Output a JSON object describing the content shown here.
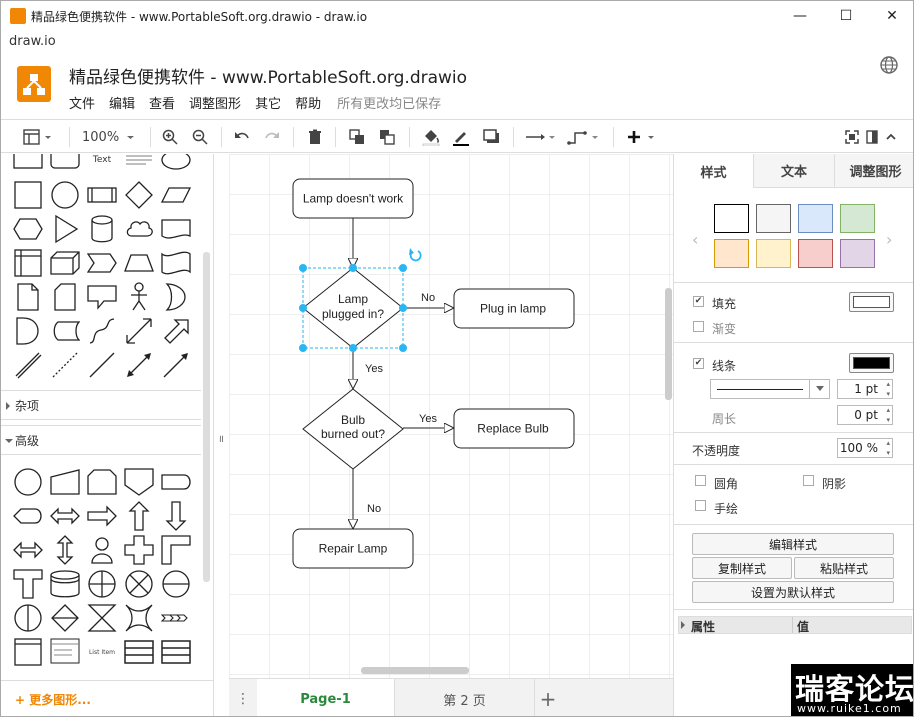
{
  "window": {
    "title": "精品绿色便携软件 - www.PortableSoft.org.drawio - draw.io",
    "minimize": "—",
    "maximize": "☐",
    "close": "✕"
  },
  "app_tab": "draw.io",
  "header": {
    "doc_title": "精品绿色便携软件 - www.PortableSoft.org.drawio",
    "menus": [
      "文件",
      "编辑",
      "查看",
      "调整图形",
      "其它",
      "帮助"
    ],
    "save_status": "所有更改均已保存"
  },
  "toolbar": {
    "zoom": "100%"
  },
  "left_panel": {
    "text_shape_label": "Text",
    "sections": {
      "misc": "杂项",
      "advanced": "高级"
    },
    "list_item_label": "List Item",
    "more_shapes": "+ 更多图形..."
  },
  "diagram": {
    "nodes": {
      "start": "Lamp doesn't work",
      "decision1_l1": "Lamp",
      "decision1_l2": "plugged in?",
      "plug": "Plug in lamp",
      "decision2_l1": "Bulb",
      "decision2_l2": "burned out?",
      "replace": "Replace Bulb",
      "repair": "Repair Lamp"
    },
    "edges": {
      "no1": "No",
      "yes1": "Yes",
      "yes2": "Yes",
      "no2": "No"
    }
  },
  "pages": {
    "tabs": [
      "Page-1",
      "第 2 页"
    ],
    "add": "+"
  },
  "right_panel": {
    "tabs": [
      "样式",
      "文本",
      "调整图形"
    ],
    "swatches": [
      "#ffffff",
      "#f5f5f5",
      "#dae8fc",
      "#d5e8d4",
      "#ffe6cc",
      "#fff2cc",
      "#f8cecc",
      "#e1d5e7"
    ],
    "swatch_borders": [
      "#000000",
      "#666666",
      "#6c8ebf",
      "#82b366",
      "#d79b00",
      "#d6b656",
      "#b85450",
      "#9673a6"
    ],
    "fill_label": "填充",
    "gradient_label": "渐变",
    "line_label": "线条",
    "line_width": "1 pt",
    "perimeter_label": "周长",
    "perimeter_value": "0 pt",
    "opacity_label": "不透明度",
    "opacity_value": "100 %",
    "rounded_label": "圆角",
    "shadow_label": "阴影",
    "sketch_label": "手绘",
    "edit_style": "编辑样式",
    "copy_style": "复制样式",
    "paste_style": "粘贴样式",
    "set_default_style": "设置为默认样式",
    "prop_header": "属性",
    "value_header": "值",
    "colors": {
      "fill": "#ffffff",
      "line": "#000000"
    }
  },
  "watermark": {
    "title": "瑞客论坛",
    "url": "www.ruike1.com"
  }
}
